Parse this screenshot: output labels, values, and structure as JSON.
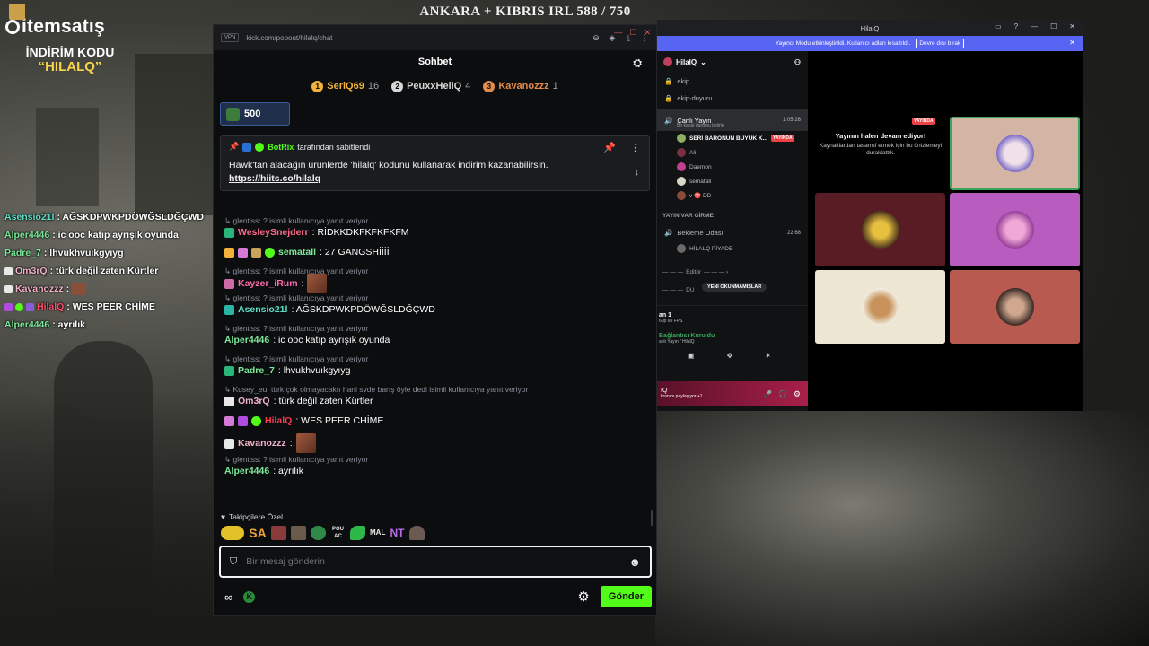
{
  "stream": {
    "title": "ANKARA + KIBRIS IRL 588 / 750",
    "brand": "itemsatış",
    "promo_title": "İNDİRİM KODU",
    "promo_code": "“HILALQ”"
  },
  "overlay_chat": [
    {
      "user": "Asensio21l",
      "text": " : AĞSKDPWKPDÖWĞSLDĞÇWD",
      "color": "#5ee0c8"
    },
    {
      "user": "Alper4446",
      "text": " : ic ooc katıp ayrışık oyunda",
      "color": "#7ce89a"
    },
    {
      "user": "Padre_7",
      "text": " : lhvukhvuıkgyıyg",
      "color": "#7ce89a"
    },
    {
      "user": "Om3rQ",
      "text": " : türk değil zaten Kürtler",
      "color": "#f3b2c8"
    },
    {
      "user": "Kavanozzz",
      "text": " :",
      "color": "#f3b2c8"
    },
    {
      "user": "HilalQ",
      "text": " : WES PEER CHİME",
      "color": "#ff4d6a"
    },
    {
      "user": "Alper4446",
      "text": " : ayrılık",
      "color": "#7ce89a"
    }
  ],
  "kick": {
    "url": "kick.com/popout/hilalq/chat",
    "vpn": "VPN",
    "title": "Sohbet",
    "leaderboard": [
      {
        "rank": "1",
        "name": "SeriQ69",
        "count": "16",
        "color": "#f0b23a"
      },
      {
        "rank": "2",
        "name": "PeuxxHellQ",
        "count": "4",
        "color": "#d6d6d6"
      },
      {
        "rank": "3",
        "name": "Kavanozzz",
        "count": "1",
        "color": "#e28b4a"
      }
    ],
    "goal_value": "500",
    "pinned": {
      "by_user": "BotRix",
      "by_suffix": " tarafından sabitlendi",
      "text": "Hawk'tan alacağın ürünlerde 'hilalq' kodunu kullanarak indirim kazanabilirsin.",
      "link": "https://hiits.co/hilalq"
    },
    "messages": [
      {
        "reply": "glentiss: ? isimli kullanıcıya yanıt veriyor",
        "user": "WesleySnejderr",
        "text": ": RİDKKDKFKFKFKFM",
        "color": "#ff6b8a"
      },
      {
        "reply": "",
        "user": "sematall",
        "text": ": 27 GANGSHİİİİ",
        "color": "#7ce89a"
      },
      {
        "reply": "glentiss: ? isimli kullanıcıya yanıt veriyor",
        "user": "Kayzer_iRum",
        "text": ":",
        "color": "#ff6bb0"
      },
      {
        "reply": "glentiss: ? isimli kullanıcıya yanıt veriyor",
        "user": "Asensio21l",
        "text": ": AĞSKDPWKPDÖWĞSLDĞÇWD",
        "color": "#5ee0c8"
      },
      {
        "reply": "glentiss: ? isimli kullanıcıya yanıt veriyor",
        "user": "Alper4446",
        "text": ": ic ooc katıp ayrışık oyunda",
        "color": "#7ce89a"
      },
      {
        "reply": "glentiss: ? isimli kullanıcıya yanıt veriyor",
        "user": "Padre_7",
        "text": ": lhvukhvuıkgyıyg",
        "color": "#7ce89a"
      },
      {
        "reply": "Kusey_eu: türk çok olmayacaktı hani svde barış öyle dedi isimli kullanıcıya yanıt veriyor",
        "user": "Om3rQ",
        "text": ": türk değil zaten Kürtler",
        "color": "#f3b2c8"
      },
      {
        "reply": "",
        "user": "HilalQ",
        "text": ": WES PEER CHİME",
        "color": "#ff3b4e"
      },
      {
        "reply": "",
        "user": "Kavanozzz",
        "text": ":",
        "color": "#f3b2c8"
      },
      {
        "reply": "glentiss: ? isimli kullanıcıya yanıt veriyor",
        "user": "Alper4446",
        "text": ": ayrılık",
        "color": "#7ce89a"
      }
    ],
    "followers_label": "Takipçilere Özel",
    "emote_labels": [
      "SA",
      "POU AC",
      "MAL",
      "NT"
    ],
    "input_placeholder": "Bir mesaj gönderin",
    "send_label": "Gönder"
  },
  "discord": {
    "window_title": "HilalQ",
    "banner_text": "Yayıncı Modu etkinleştirildi. Kullanıcı adları kısaltıldı.",
    "banner_button": "Devre dışı bırak",
    "server_name": "HilalQ",
    "channels": [
      {
        "name": "ekip"
      },
      {
        "name": "ekip-duyuru"
      }
    ],
    "voice_channel": {
      "name": "Canlı Yayın",
      "time": "1:05:26",
      "sub": "Bir kanal durumu belirle"
    },
    "voice_users": [
      {
        "name": "SERİ BARONUN BÜYÜK K...",
        "live": "YAYINDA"
      },
      {
        "name": "Ali"
      },
      {
        "name": "Daemon"
      },
      {
        "name": "sematall"
      },
      {
        "name": "v ♈ DD"
      }
    ],
    "category": "YAYIN VAR GİRME",
    "waiting_room": {
      "name": "Bekleme Odası",
      "time": "22:68"
    },
    "waiting_user": "HİLALQ PİYADE",
    "editor_cat": "Editör",
    "du_cat": "DU",
    "unread_pill": "YENİ OKUNMAMIŞLAR",
    "voice_panel": {
      "line1": "an 1",
      "line2": "60p 60 FPS",
      "status": "Bağlantısı Kuruldu",
      "status_sub": "anlı Yayın / HilalQ"
    },
    "bottom": {
      "name": "IQ",
      "sub": "kranını paylaşıyor +1"
    },
    "live_tag": "YAYINDA",
    "live_title": "Yayının halen devam ediyor!",
    "live_sub": "Kaynaklardan tasarruf etmek için bu önizlemeyi duraklattık."
  },
  "colors": {
    "kick_green": "#53fc18",
    "discord_blurple": "#5865f2"
  }
}
